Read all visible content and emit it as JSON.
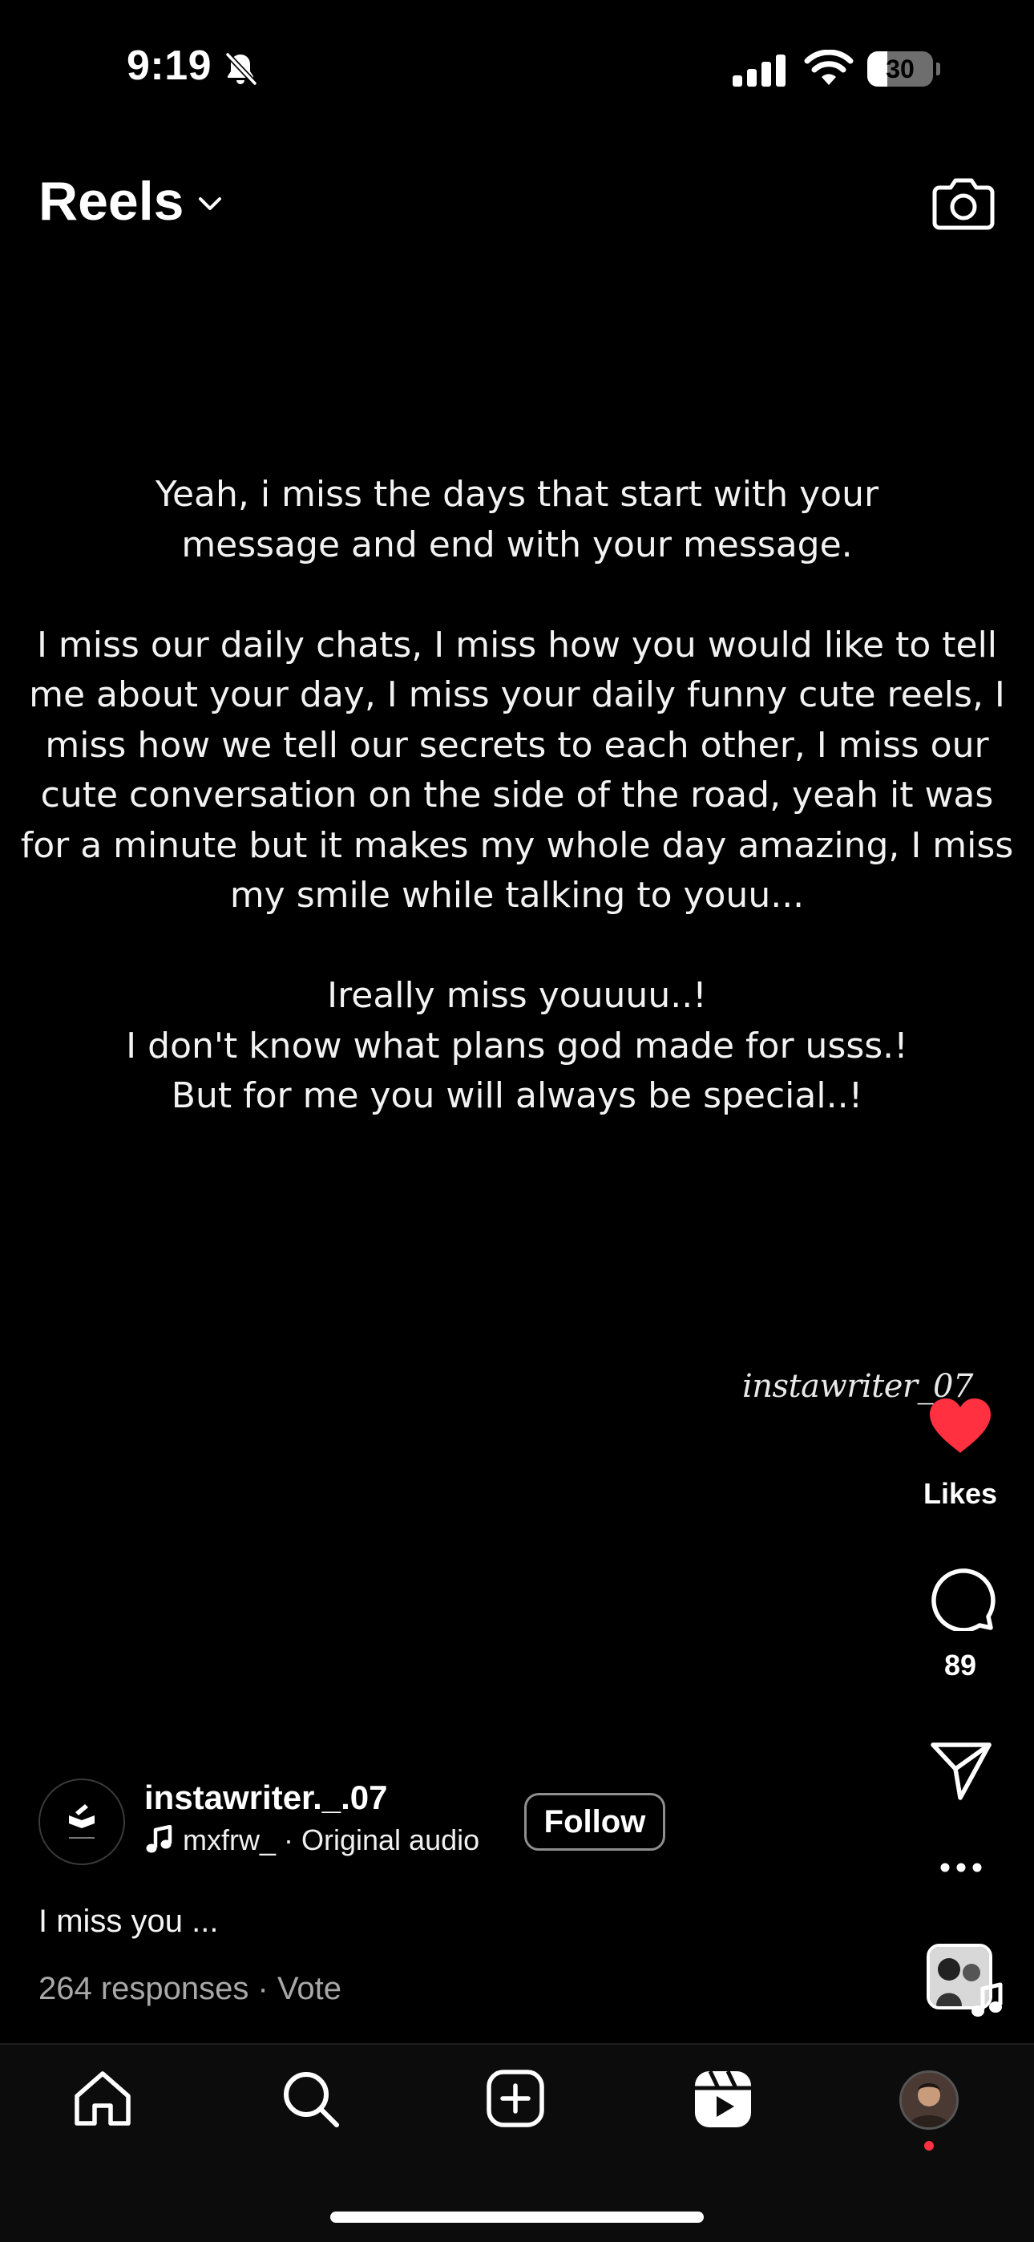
{
  "status_bar": {
    "time": "9:19",
    "battery": "30",
    "battery_level_percent": 30
  },
  "header": {
    "title": "Reels"
  },
  "reel": {
    "text": "Yeah, i miss the days that start with your\nmessage and end with your message.\n\nI miss our daily chats, I miss how you would like to tell\nme about your day, I miss your daily funny cute reels, I\nmiss how we tell our secrets to each other, I miss our\ncute conversation on the side of the road, yeah it was\nfor a minute but it makes my whole day amazing, I miss\nmy smile while talking to youu...\n\nIreally miss youuuu..!\nI don't know what plans god made for usss.!\nBut for me you will always be special..!",
    "watermark": "instawriter_07"
  },
  "actions": {
    "likes_label": "Likes",
    "comment_count": "89"
  },
  "author": {
    "username": "instawriter._.07",
    "audio_artist": "mxfrw_",
    "audio_separator": " · ",
    "audio_name": "Original audio",
    "follow_label": "Follow"
  },
  "caption": "I miss you ...",
  "poll": {
    "responses": "264 responses",
    "separator": " · ",
    "vote_label": "Vote"
  },
  "colors": {
    "background": "#000000",
    "like_heart": "#ff3040",
    "secondary_text": "#a8a8a8",
    "nav_background": "#0c0c0c"
  },
  "icons": {
    "bell": "bell-slash-icon",
    "camera": "camera-icon",
    "heart": "heart-filled-icon",
    "comment": "comment-icon",
    "share": "paper-plane-icon",
    "home": "home-icon",
    "search": "search-icon",
    "create": "plus-square-icon",
    "reels": "reels-icon"
  }
}
